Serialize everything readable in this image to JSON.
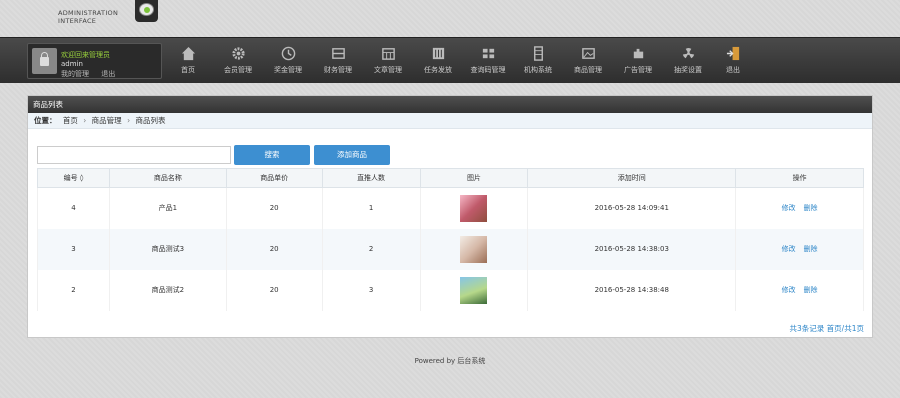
{
  "brand": {
    "line1": "ADMINISTRATION",
    "line2": "INTERFACE"
  },
  "user": {
    "welcome": "欢迎回来管理员",
    "name": "admin",
    "links": [
      "我的管理",
      "退出"
    ]
  },
  "nav": [
    {
      "label": "首页",
      "icon": "home-icon"
    },
    {
      "label": "会员管理",
      "icon": "gear-icon"
    },
    {
      "label": "奖金管理",
      "icon": "clock-icon"
    },
    {
      "label": "财务管理",
      "icon": "box-icon"
    },
    {
      "label": "文章管理",
      "icon": "calendar-icon"
    },
    {
      "label": "任务发放",
      "icon": "sliders-icon"
    },
    {
      "label": "查询码管理",
      "icon": "grid-icon"
    },
    {
      "label": "机构系统",
      "icon": "server-icon"
    },
    {
      "label": "商品管理",
      "icon": "image-icon"
    },
    {
      "label": "广告管理",
      "icon": "puzzle-icon"
    },
    {
      "label": "抽奖设置",
      "icon": "radiation-icon"
    },
    {
      "label": "退出",
      "icon": "exit-icon"
    }
  ],
  "panel": {
    "title": "商品列表",
    "breadcrumb": {
      "prefix": "位置：",
      "items": [
        "首页",
        "商品管理",
        "商品列表"
      ]
    }
  },
  "toolbar": {
    "search_placeholder": "",
    "search_label": "搜索",
    "add_label": "添加商品"
  },
  "table": {
    "headers": [
      "编号 ◊",
      "商品名称",
      "商品单价",
      "直推人数",
      "图片",
      "添加时间",
      "操作"
    ],
    "rows": [
      {
        "id": "4",
        "name": "产品1",
        "price": "20",
        "referrals": "1",
        "image": "thumb-1",
        "time": "2016-05-28 14:09:41"
      },
      {
        "id": "3",
        "name": "商品测试3",
        "price": "20",
        "referrals": "2",
        "image": "thumb-2",
        "time": "2016-05-28 14:38:03"
      },
      {
        "id": "2",
        "name": "商品测试2",
        "price": "20",
        "referrals": "3",
        "image": "thumb-3",
        "time": "2016-05-28 14:38:48"
      }
    ],
    "actions": {
      "edit": "修改",
      "delete": "删除"
    }
  },
  "pager": "共3条记录 首页/共1页",
  "footer": "Powered by 后台系统",
  "colors": {
    "accent": "#3d8fd1",
    "link": "#2d86c8",
    "welcome": "#9ad23c"
  }
}
